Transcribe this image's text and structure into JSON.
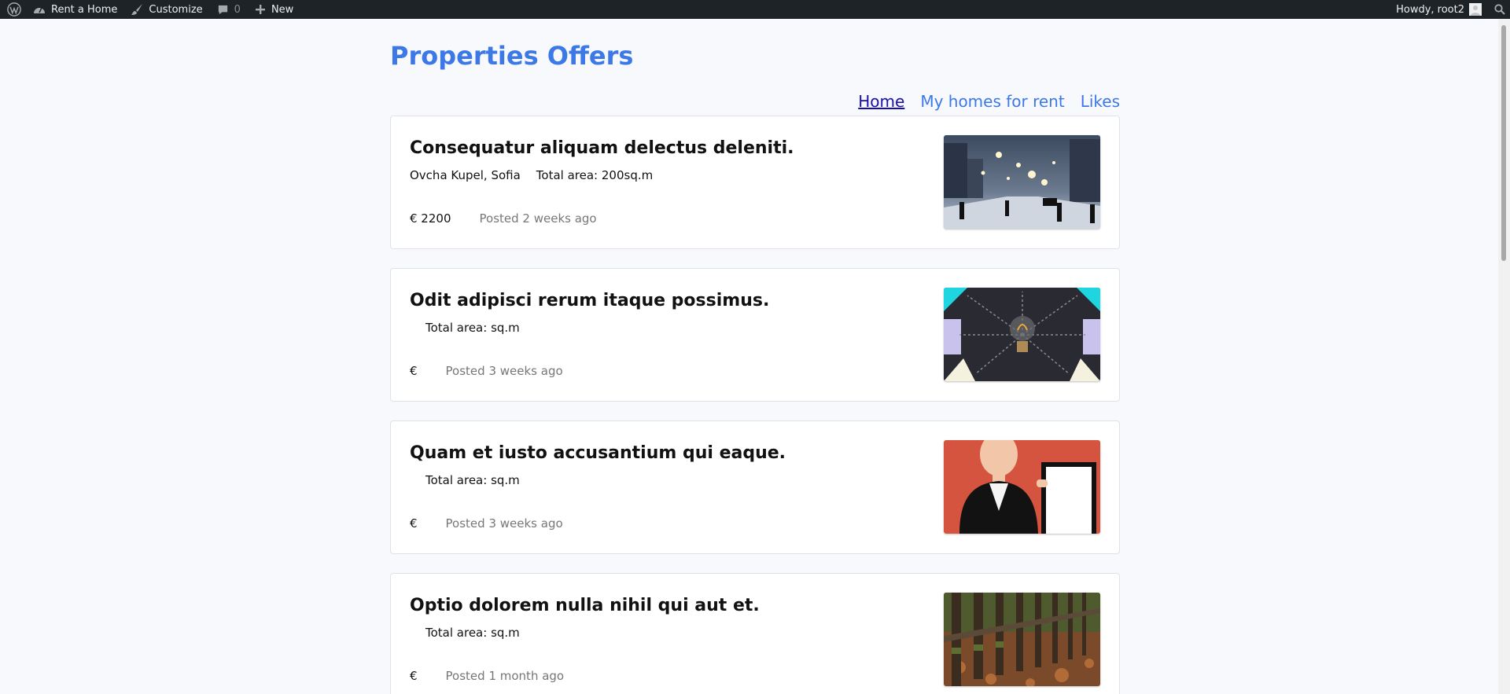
{
  "adminbar": {
    "site_name": "Rent a Home",
    "customize": "Customize",
    "comments_count": "0",
    "new_label": "New",
    "howdy": "Howdy, root2",
    "icons": [
      "wordpress-icon",
      "dashboard-icon",
      "brush-icon",
      "comment-icon",
      "plus-icon",
      "avatar-icon",
      "search-icon"
    ]
  },
  "page": {
    "title": "Properties Offers"
  },
  "nav": {
    "items": [
      {
        "label": "Home",
        "active": true
      },
      {
        "label": "My homes for rent",
        "active": false
      },
      {
        "label": "Likes",
        "active": false
      }
    ]
  },
  "listings": [
    {
      "title": "Consequatur aliquam delectus deleniti.",
      "location": "Ovcha Kupel, Sofia",
      "area": "Total area: 200sq.m",
      "price": "€ 2200",
      "posted": "Posted 2 weeks ago",
      "image": "snowy-street"
    },
    {
      "title": "Odit adipisci rerum itaque possimus.",
      "location": "",
      "area": "Total area: sq.m",
      "price": "€",
      "posted": "Posted 3 weeks ago",
      "image": "light-bulb"
    },
    {
      "title": "Quam et iusto accusantium qui eaque.",
      "location": "",
      "area": "Total area: sq.m",
      "price": "€",
      "posted": "Posted 3 weeks ago",
      "image": "business-woman-board"
    },
    {
      "title": "Optio dolorem nulla nihil qui aut et.",
      "location": "",
      "area": "Total area: sq.m",
      "price": "€",
      "posted": "Posted 1 month ago",
      "image": "wooden-fence"
    }
  ]
}
